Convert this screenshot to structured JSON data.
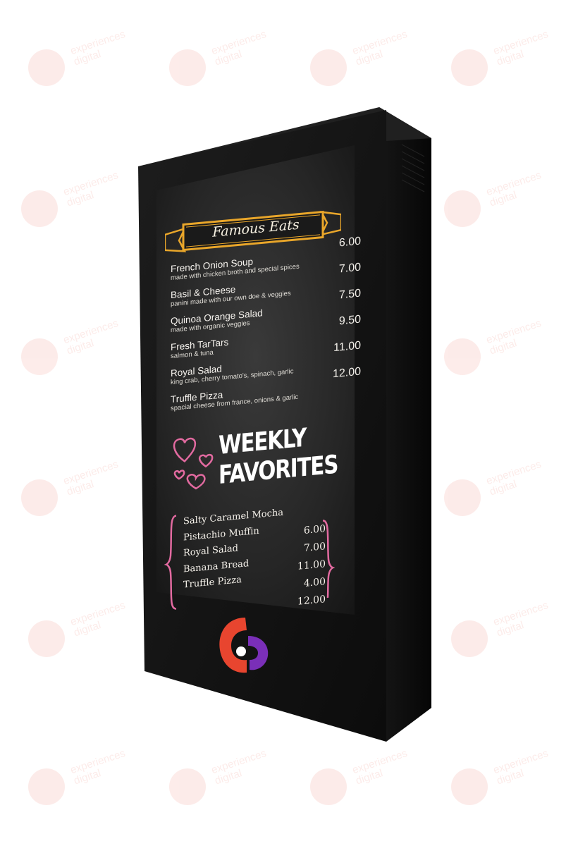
{
  "watermark": {
    "line1": "experiences",
    "line2": "digital"
  },
  "menu": {
    "title": "Famous Eats",
    "items": [
      {
        "name": "French Onion Soup",
        "description": "made with chicken broth and special spices",
        "price": "6.00"
      },
      {
        "name": "Basil & Cheese",
        "description": "panini made with our own doe & veggies",
        "price": "7.00"
      },
      {
        "name": "Quinoa Orange Salad",
        "description": "made with organic veggies",
        "price": "7.50"
      },
      {
        "name": "Fresh TarTars",
        "description": "salmon & tuna",
        "price": "9.50"
      },
      {
        "name": "Royal Salad",
        "description": "king crab, cherry tomato's, spinach, garlic",
        "price": "11.00"
      },
      {
        "name": "Truffle Pizza",
        "description": "spacial cheese from france, onions & garlic",
        "price": "12.00"
      }
    ]
  },
  "weekly": {
    "line1": "WEEKLY",
    "line2": "FAVORITES",
    "names": [
      "Salty Caramel Mocha",
      "Pistachio Muffin",
      "Royal Salad",
      "Banana Bread",
      "Truffle Pizza"
    ],
    "prices": [
      "6.00",
      "7.00",
      "11.00",
      "4.00",
      "12.00"
    ]
  },
  "colors": {
    "banner_gold": "#e9a62a",
    "heart_pink": "#e26aa0",
    "logo_red": "#e8452f",
    "logo_purple": "#7a2fb8",
    "cabinet": "#111111"
  }
}
